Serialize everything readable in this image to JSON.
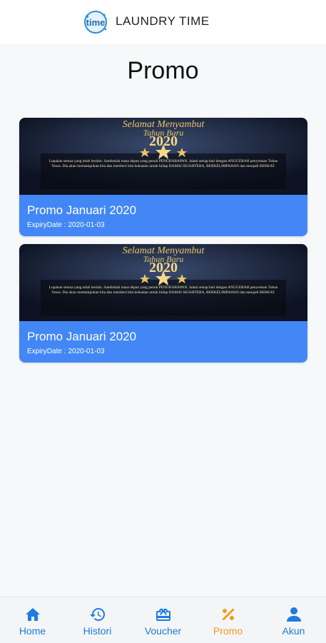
{
  "app": {
    "name": "LAUNDRY TIME",
    "logo_text": "time"
  },
  "page": {
    "title": "Promo"
  },
  "banner": {
    "line1": "Selamat Menyambut",
    "line2": "Tahun Baru",
    "year": "2020",
    "body": "Lupakan semua yang telah berlalu. Sambutlah masa depan yang penuh PENGHARAPAN. Jalani setiap hari dengan ANUGERAH penyertaan Tuhan Yesus. Dia akan memampukan kita dan memberi kita kekuatan untuk hidup DAMAI SEJAHTERA, BERKELIMPAHAN dan menjadi BERKAT."
  },
  "promos": [
    {
      "title": "Promo Januari 2020",
      "expiry_label": "ExpiryDate :",
      "expiry_date": "2020-01-03"
    },
    {
      "title": "Promo Januari 2020",
      "expiry_label": "ExpiryDate :",
      "expiry_date": "2020-01-03"
    }
  ],
  "tabs": [
    {
      "label": "Home",
      "icon": "home-icon",
      "active": false
    },
    {
      "label": "Histori",
      "icon": "history-icon",
      "active": false
    },
    {
      "label": "Voucher",
      "icon": "voucher-icon",
      "active": false
    },
    {
      "label": "Promo",
      "icon": "percent-icon",
      "active": true
    },
    {
      "label": "Akun",
      "icon": "account-icon",
      "active": false
    }
  ],
  "colors": {
    "accent": "#4287f5",
    "tab_inactive": "#1e7be0",
    "tab_active": "#f59a1b",
    "banner_bg": "#12192b",
    "banner_gold": "#e9c46a"
  }
}
